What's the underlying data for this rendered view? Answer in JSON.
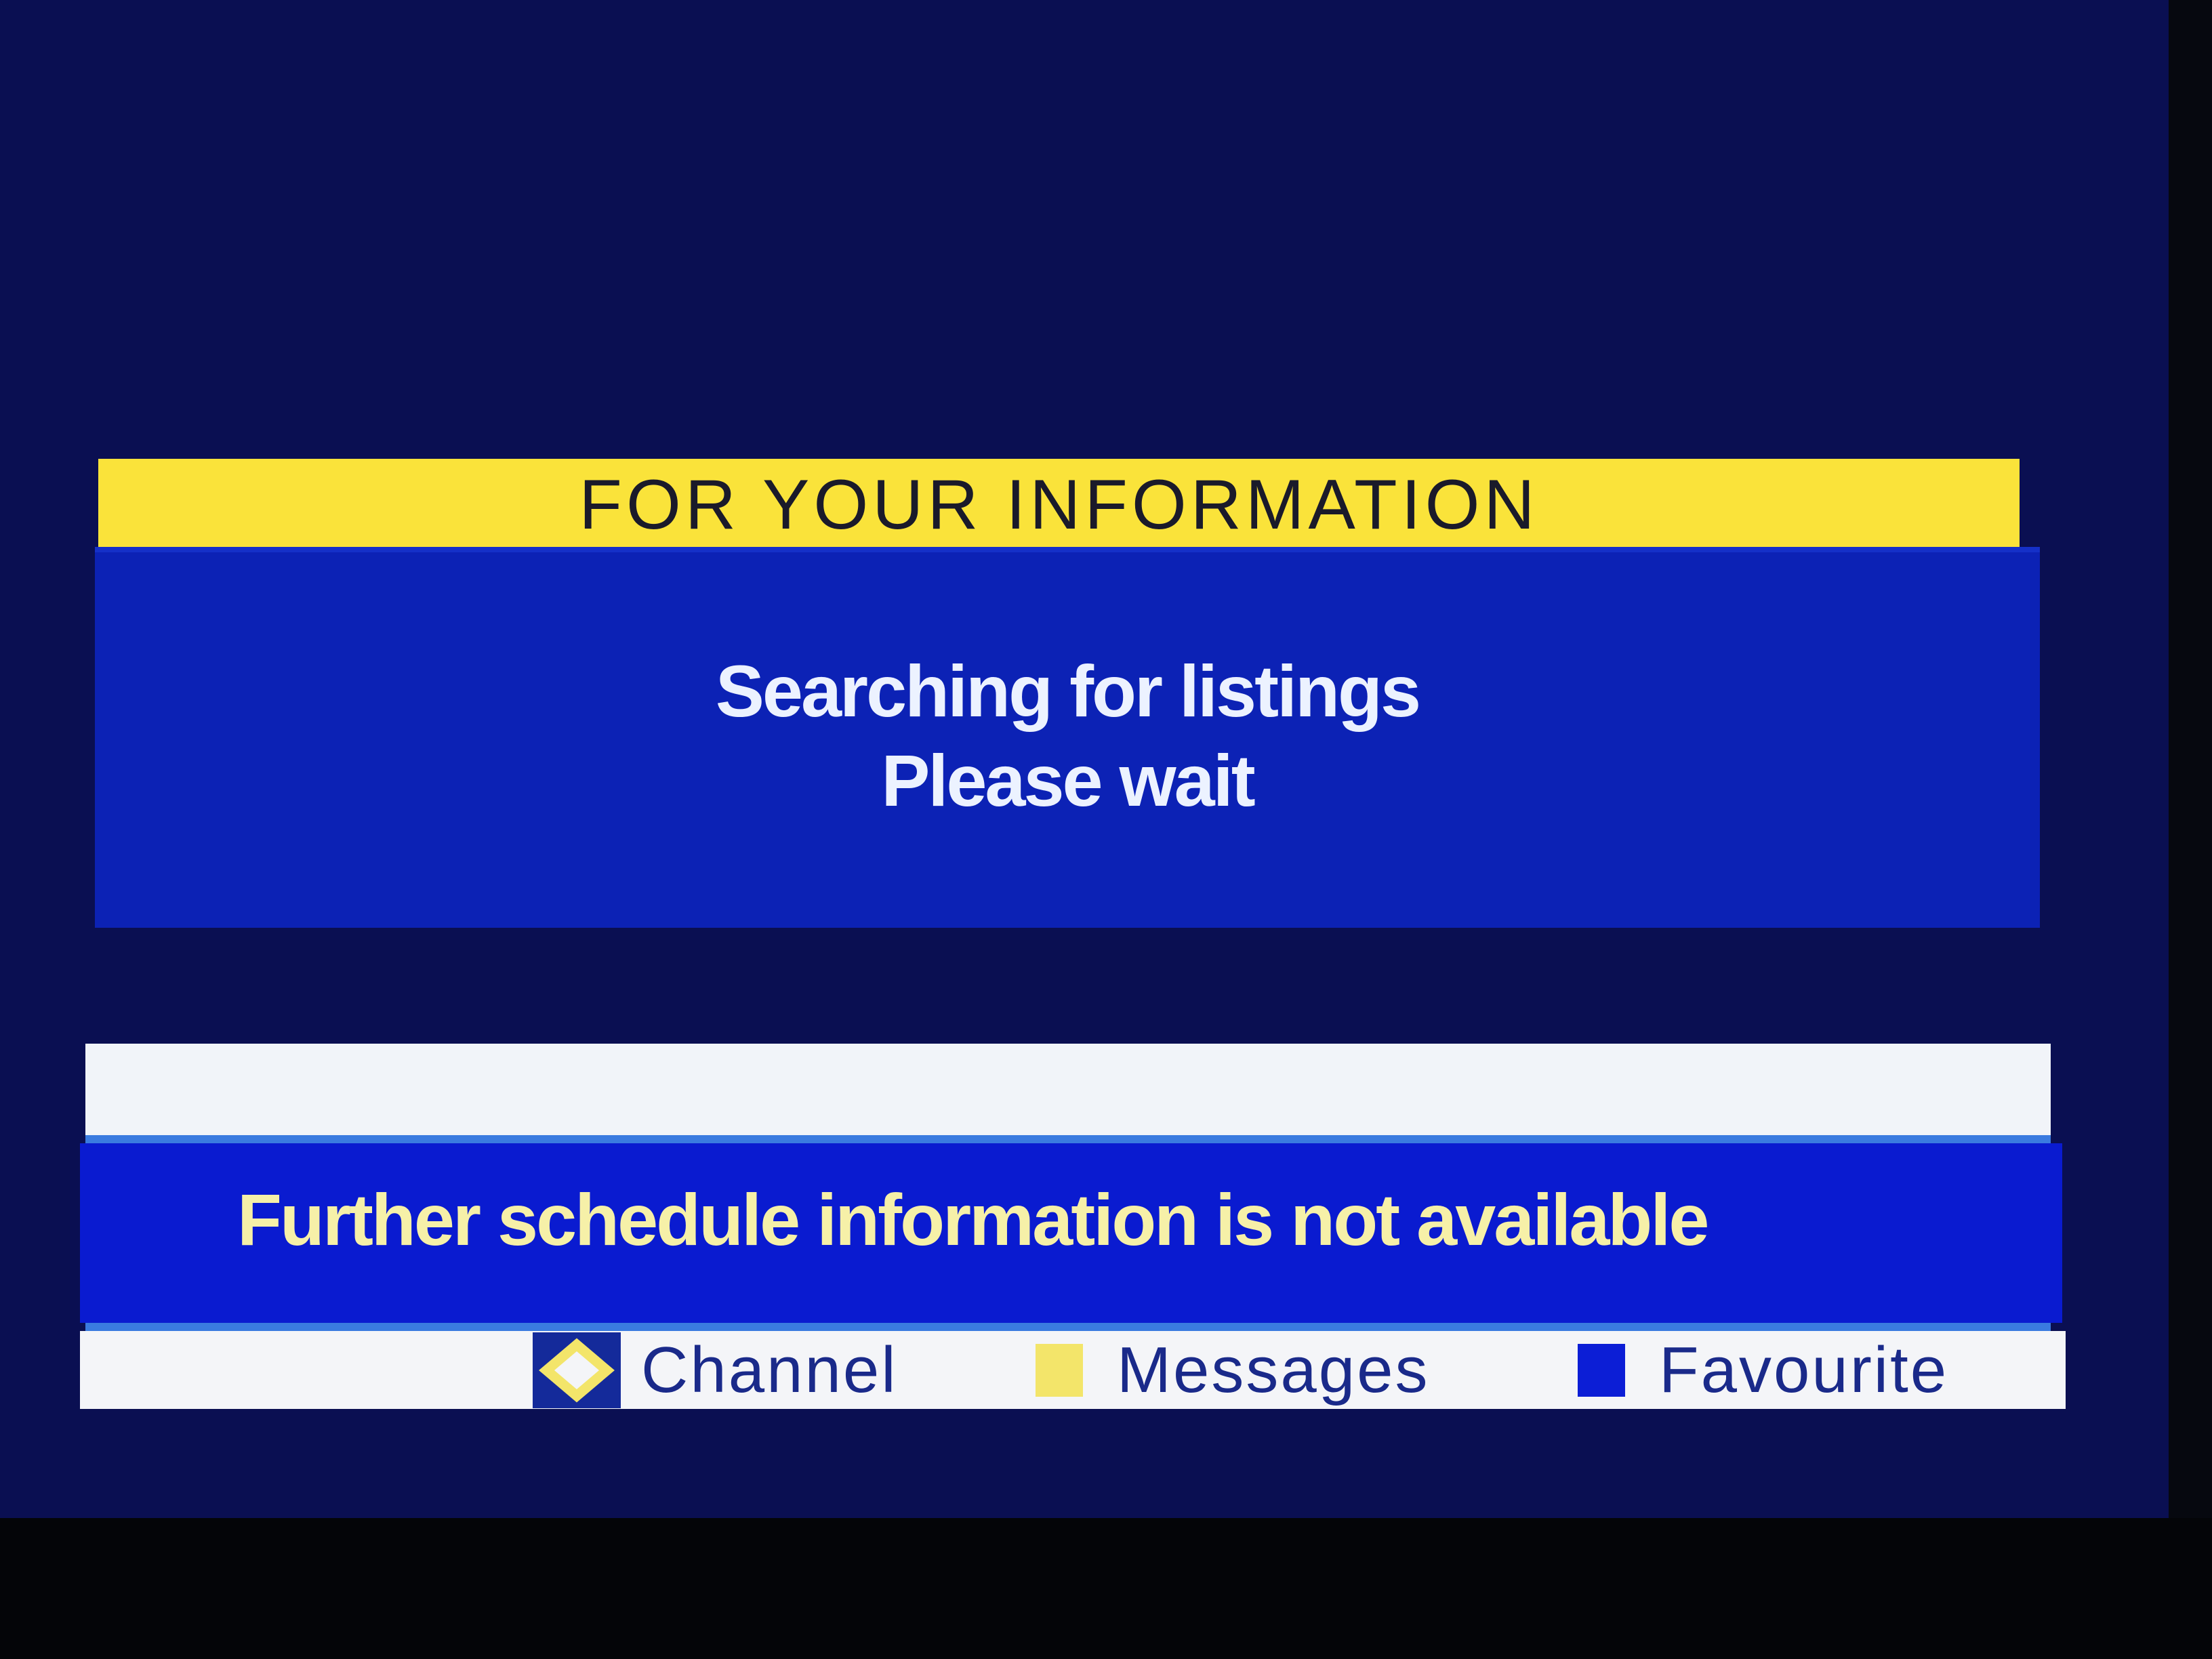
{
  "info": {
    "header": "FOR YOUR INFORMATION",
    "line1": "Searching for listings",
    "line2": "Please wait"
  },
  "schedule": {
    "message": "Further schedule information is not available"
  },
  "legend": {
    "channel": {
      "label": "Channel",
      "icon": "channel-navigation-icon"
    },
    "messages": {
      "label": "Messages",
      "icon": "yellow-key-icon",
      "color": "#f3e56a"
    },
    "favourite": {
      "label": "Favourite",
      "icon": "blue-key-icon",
      "color": "#0c1ed6"
    }
  },
  "colors": {
    "screen_background": "#0a0f52",
    "header_yellow": "#fae33a",
    "panel_blue": "#0c22b5",
    "message_bar_blue": "#0a1bd0",
    "message_text": "#f6f0a8",
    "footer_background": "#f4f5f8"
  }
}
